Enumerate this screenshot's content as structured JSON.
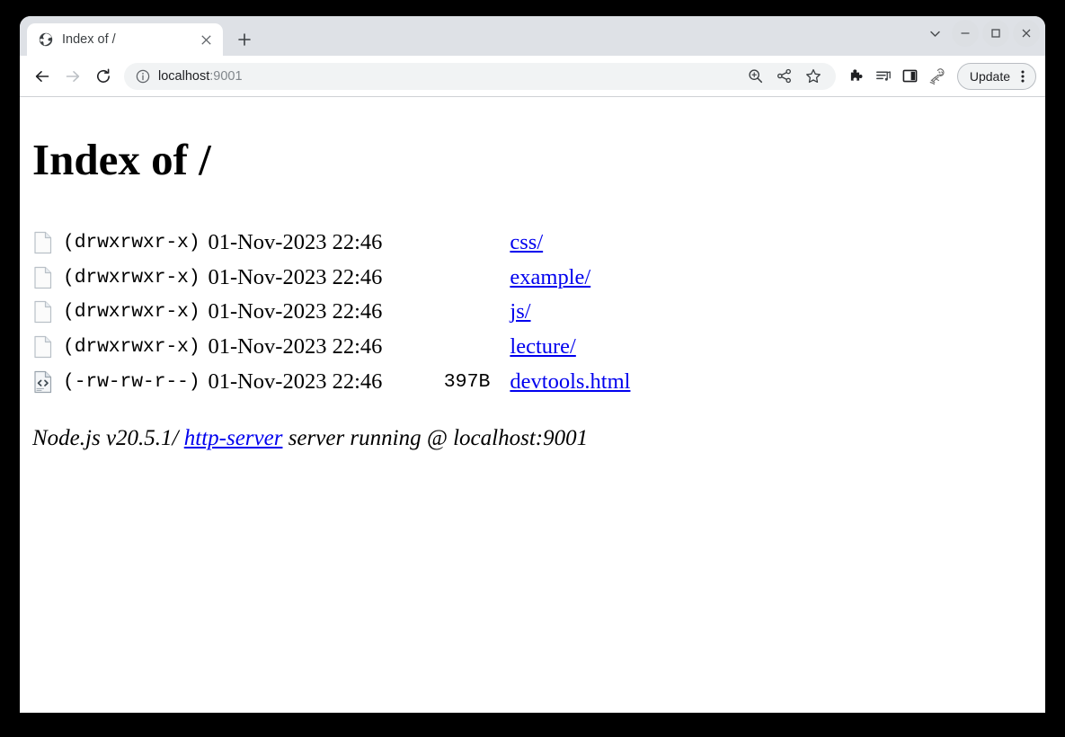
{
  "window": {
    "controls": {
      "tab_search": "tab-search-chevron",
      "minimize": "minimize",
      "maximize": "maximize",
      "close": "close"
    }
  },
  "tabstrip": {
    "tabs": [
      {
        "title": "Index of /",
        "favicon": "globe-icon",
        "close_label": "×"
      }
    ],
    "new_tab_label": "+"
  },
  "toolbar": {
    "back_icon": "back-arrow-icon",
    "forward_icon": "forward-arrow-icon",
    "reload_icon": "reload-icon",
    "omnibox": {
      "info_icon": "info-circle-icon",
      "host": "localhost",
      "port": ":9001"
    },
    "actions": [
      {
        "name": "zoom-in-icon"
      },
      {
        "name": "share-icon"
      },
      {
        "name": "bookmark-star-icon"
      },
      {
        "name": "extensions-puzzle-icon"
      },
      {
        "name": "reading-list-icon"
      },
      {
        "name": "side-panel-icon"
      },
      {
        "name": "profile-avatar-icon"
      }
    ],
    "update_button": {
      "label": "Update",
      "menu_icon": "three-dot-menu-icon"
    }
  },
  "content": {
    "title": "Index of /",
    "rows": [
      {
        "icon": "file-page-icon",
        "permissions": "(drwxrwxr-x)",
        "datetime": "01-Nov-2023 22:46",
        "size": "",
        "name": "css/"
      },
      {
        "icon": "file-page-icon",
        "permissions": "(drwxrwxr-x)",
        "datetime": "01-Nov-2023 22:46",
        "size": "",
        "name": "example/"
      },
      {
        "icon": "file-page-icon",
        "permissions": "(drwxrwxr-x)",
        "datetime": "01-Nov-2023 22:46",
        "size": "",
        "name": "js/"
      },
      {
        "icon": "file-page-icon",
        "permissions": "(drwxrwxr-x)",
        "datetime": "01-Nov-2023 22:46",
        "size": "",
        "name": "lecture/"
      },
      {
        "icon": "html-file-icon",
        "permissions": "(-rw-rw-r--)",
        "datetime": "01-Nov-2023 22:46",
        "size": "397B",
        "name": "devtools.html"
      }
    ],
    "footer": {
      "prefix": "Node.js v20.5.1/ ",
      "link": "http-server",
      "suffix": " server running @ localhost:9001"
    }
  },
  "colors": {
    "link": "#0000EE",
    "tabstrip_bg": "#DEE1E6",
    "omnibox_bg": "#F1F3F4",
    "page_bg": "#FFFFFF",
    "desktop_bg": "#000000"
  }
}
